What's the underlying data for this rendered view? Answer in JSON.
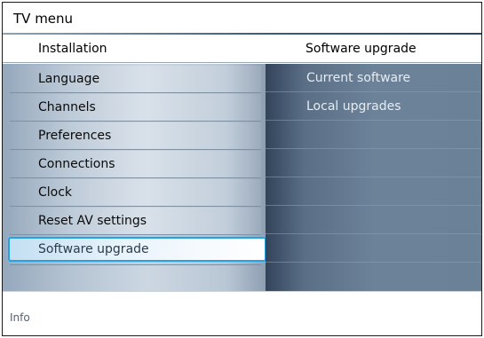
{
  "window": {
    "title": "TV menu"
  },
  "header": {
    "left": "Installation",
    "right": "Software upgrade"
  },
  "menu": {
    "items": [
      {
        "label": "Language"
      },
      {
        "label": "Channels"
      },
      {
        "label": "Preferences"
      },
      {
        "label": "Connections"
      },
      {
        "label": "Clock"
      },
      {
        "label": "Reset AV settings"
      },
      {
        "label": "Software upgrade",
        "selected": true
      }
    ]
  },
  "submenu": {
    "items": [
      {
        "label": "Current software"
      },
      {
        "label": "Local upgrades"
      },
      {
        "label": ""
      },
      {
        "label": ""
      },
      {
        "label": ""
      },
      {
        "label": ""
      },
      {
        "label": ""
      }
    ]
  },
  "info": {
    "label": "Info"
  },
  "colors": {
    "selection_border": "#2aa1de",
    "left_panel": "#ccd7e2",
    "right_panel": "#6c8299"
  }
}
